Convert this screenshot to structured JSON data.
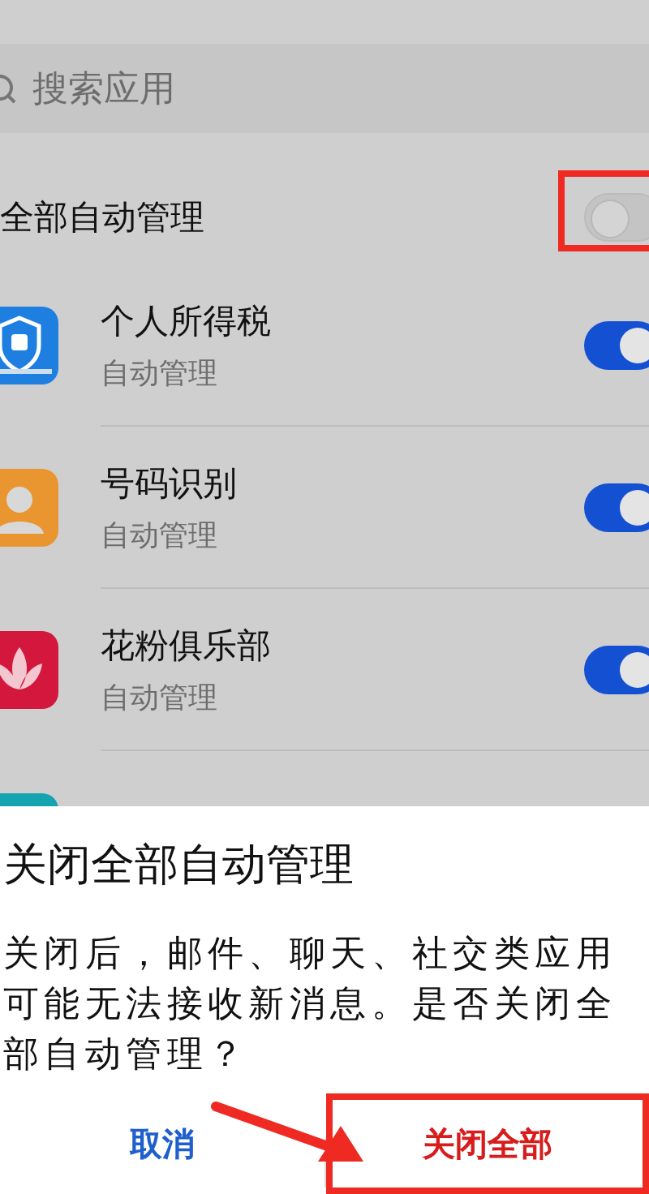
{
  "search": {
    "placeholder": "搜索应用"
  },
  "master": {
    "label": "全部自动管理",
    "on": false,
    "highlighted": true
  },
  "apps": [
    {
      "name": "个人所得税",
      "subtitle": "自动管理",
      "on": true,
      "kind": "tax"
    },
    {
      "name": "号码识别",
      "subtitle": "自动管理",
      "on": true,
      "kind": "person"
    },
    {
      "name": "花粉俱乐部",
      "subtitle": "自动管理",
      "on": true,
      "kind": "lotus"
    },
    {
      "kind": "mirror"
    }
  ],
  "dialog": {
    "title": "关闭全部自动管理",
    "message": "关闭后，邮件、聊天、社交类应用可能无法接收新消息。是否关闭全部自动管理？",
    "buttons": [
      {
        "label": "取消",
        "kind": "cancel",
        "highlighted": false
      },
      {
        "label": "关闭全部",
        "kind": "confirm",
        "highlighted": true
      }
    ]
  }
}
